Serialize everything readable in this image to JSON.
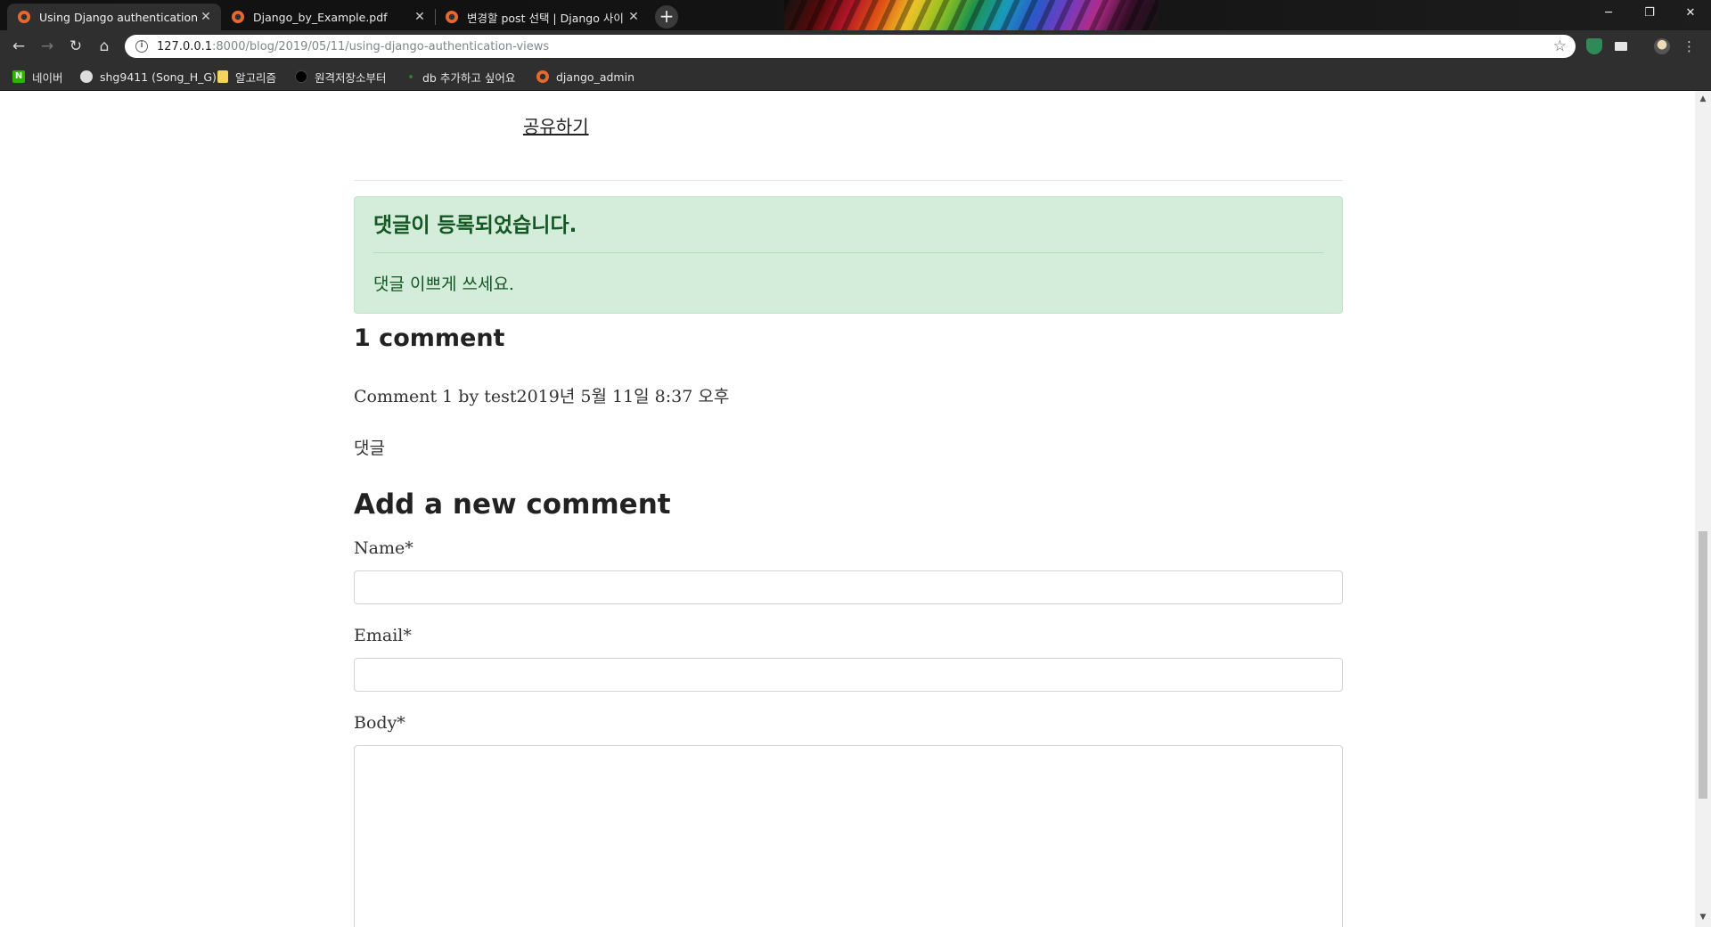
{
  "browser": {
    "tabs": [
      {
        "title": "Using Django authentication vie",
        "active": true
      },
      {
        "title": "Django_by_Example.pdf",
        "active": false
      },
      {
        "title": "변경할 post 선택 | Django 사이",
        "active": false
      }
    ],
    "new_tab": "+",
    "window_controls": {
      "minimize": "─",
      "restore": "❐",
      "close": "✕"
    },
    "nav": {
      "back": "←",
      "forward": "→",
      "reload": "↻",
      "home": "⌂"
    },
    "url": {
      "host": "127.0.0.1",
      "path": ":8000/blog/2019/05/11/using-django-authentication-views"
    },
    "bookmarks": [
      {
        "label": "네이버",
        "color": "#2db400"
      },
      {
        "label": "shg9411 (Song_H_G)",
        "color": "#dddddd"
      },
      {
        "label": "알고리즘",
        "color": "#f6d35a"
      },
      {
        "label": "원격저장소부터",
        "color": "#000000"
      },
      {
        "label": "db 추가하고 싶어요",
        "color": "#2e7d32"
      },
      {
        "label": "django_admin",
        "color": "#e66a2c"
      }
    ]
  },
  "page": {
    "share_link": "공유하기",
    "alert": {
      "title": "댓글이 등록되었습니다.",
      "message": "댓글 이쁘게 쓰세요."
    },
    "comments_heading": "1 comment",
    "comment": {
      "info": "Comment 1 by test2019년 5월 11일 8:37 오후",
      "body": "댓글"
    },
    "form": {
      "heading": "Add a new comment",
      "name_label": "Name*",
      "email_label": "Email*",
      "body_label": "Body*"
    }
  },
  "colors": {
    "alert_bg": "#d4edda",
    "alert_text": "#155724",
    "chrome_dark": "#2f2f2f"
  }
}
